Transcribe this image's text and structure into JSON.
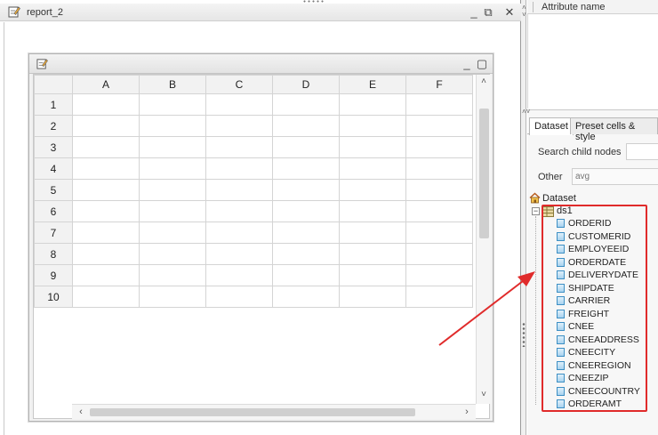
{
  "report_window": {
    "title": "report_2",
    "icon": "edit-document-icon"
  },
  "sheet": {
    "icon": "edit-document-icon",
    "columns": [
      "A",
      "B",
      "C",
      "D",
      "E",
      "F"
    ],
    "rows": [
      "1",
      "2",
      "3",
      "4",
      "5",
      "6",
      "7",
      "8",
      "9",
      "10"
    ]
  },
  "right_panel": {
    "attribute_header": "Attribute name",
    "tabs": [
      {
        "label": "Dataset",
        "active": true
      },
      {
        "label": "Preset cells & style",
        "active": false
      }
    ],
    "search_label": "Search child nodes",
    "search_value": "",
    "other_label": "Other",
    "other_placeholder": "avg",
    "tree": {
      "root_label": "Dataset",
      "node_label": "ds1",
      "fields": [
        "ORDERID",
        "CUSTOMERID",
        "EMPLOYEEID",
        "ORDERDATE",
        "DELIVERYDATE",
        "SHIPDATE",
        "CARRIER",
        "FREIGHT",
        "CNEE",
        "CNEEADDRESS",
        "CNEECITY",
        "CNEEREGION",
        "CNEEZIP",
        "CNEECOUNTRY",
        "ORDERAMT"
      ]
    }
  },
  "colors": {
    "highlight": "#e02b2b",
    "field_icon": "#3d8fc4"
  }
}
